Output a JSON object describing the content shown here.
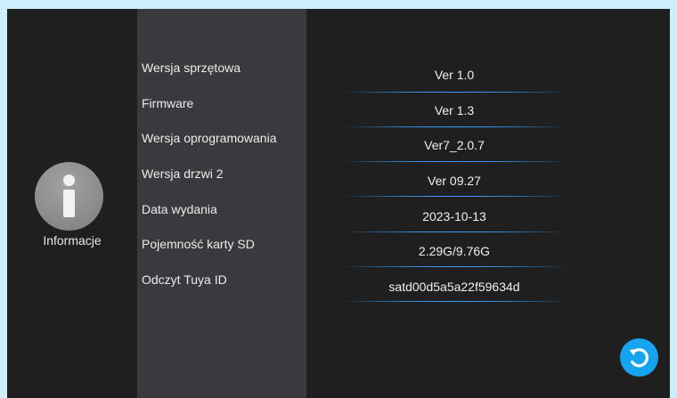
{
  "sidebar": {
    "icon": "info-icon",
    "label": "Informacje"
  },
  "info_rows": [
    {
      "label": "Wersja sprzętowa",
      "value": "Ver 1.0"
    },
    {
      "label": "Firmware",
      "value": "Ver 1.3"
    },
    {
      "label": "Wersja oprogramowania",
      "value": "Ver7_2.0.7"
    },
    {
      "label": "Wersja drzwi 2",
      "value": "Ver 09.27"
    },
    {
      "label": "Data wydania",
      "value": "2023-10-13"
    },
    {
      "label": "Pojemność karty SD",
      "value": "2.29G/9.76G"
    },
    {
      "label": "Odczyt Tuya ID",
      "value": "satd00d5a5a22f59634d"
    }
  ],
  "refresh_button": {
    "icon": "refresh-icon"
  },
  "colors": {
    "accent": "#16a3f0",
    "background": "#1f1f1f",
    "label_panel": "#3a3a3e",
    "divider": "#3aa0ff"
  }
}
